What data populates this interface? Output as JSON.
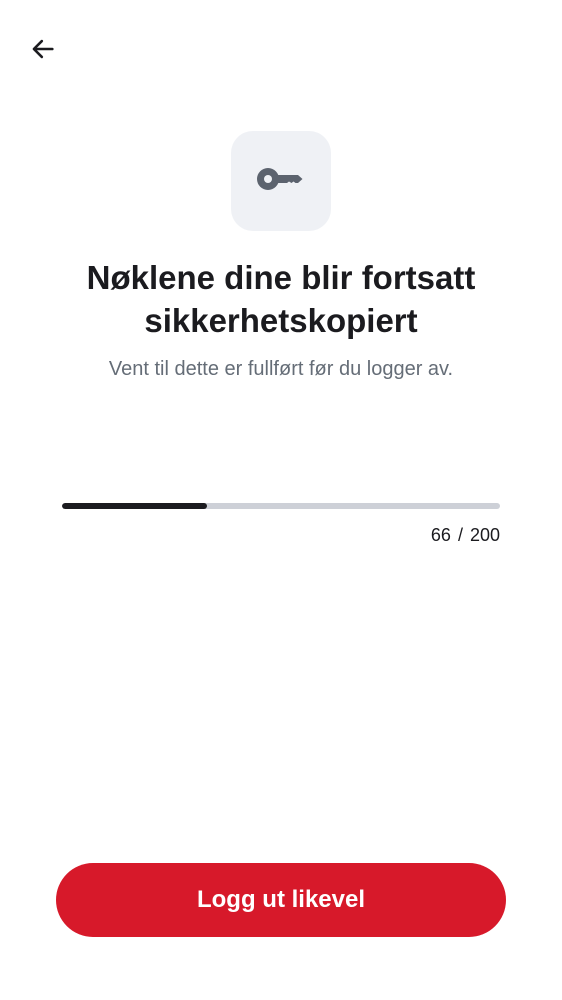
{
  "header": {
    "back_icon": "arrow-left-icon"
  },
  "hero": {
    "icon": "key-icon",
    "icon_color": "#5c636e",
    "tile_color": "#eff1f5"
  },
  "title": {
    "line1": "Nøklene dine blir fortsatt",
    "line2": "sikkerhetskopiert"
  },
  "subtitle": "Vent til dette er fullført før du logger av.",
  "progress": {
    "current": "66",
    "separator": "/",
    "total": "200",
    "fraction": 0.33
  },
  "actions": {
    "logout_label": "Logg ut likevel",
    "button_color": "#d7192a"
  }
}
